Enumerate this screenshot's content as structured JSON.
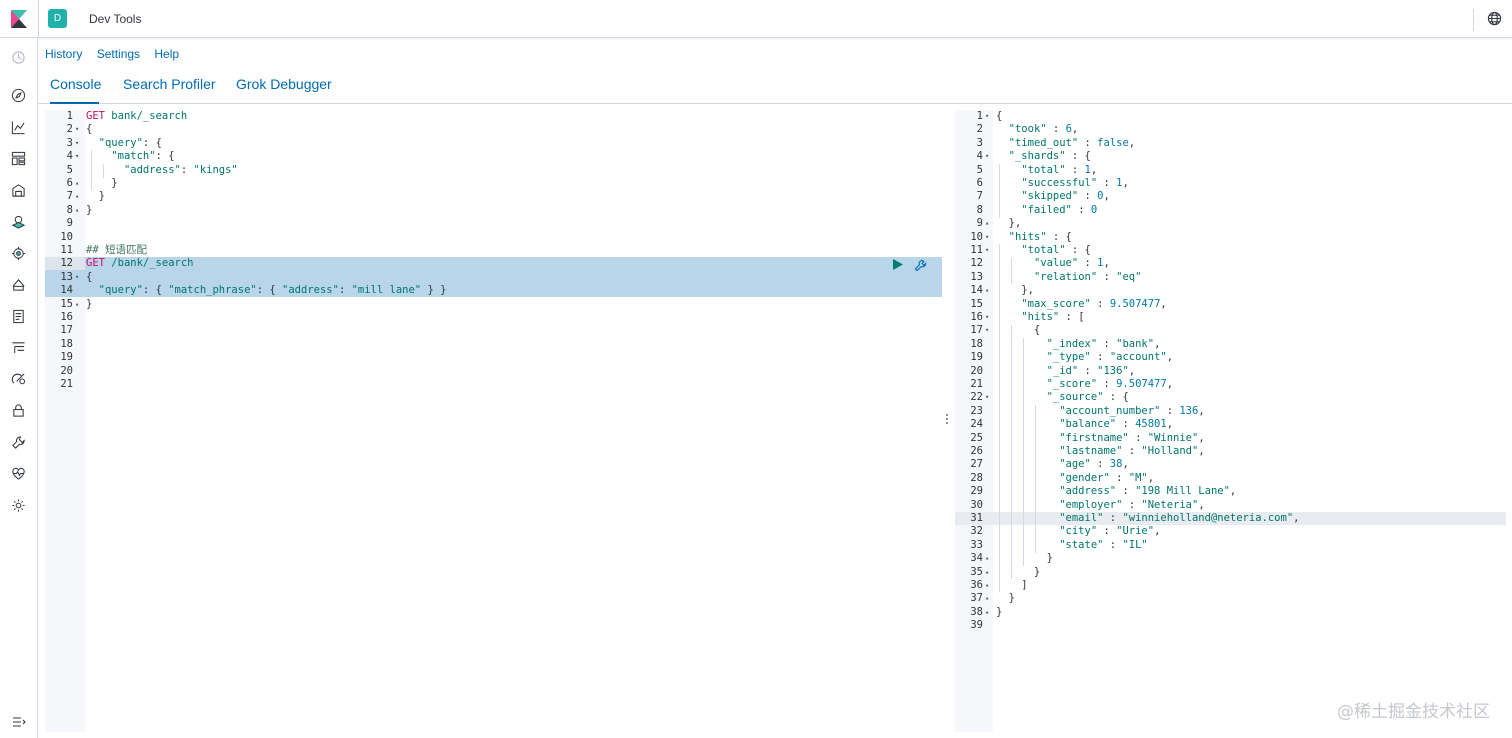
{
  "header": {
    "space_initial": "D",
    "app_title": "Dev Tools"
  },
  "nav_icons": [
    "recently-viewed-icon",
    "discover-icon",
    "visualize-icon",
    "dashboard-icon",
    "canvas-icon",
    "maps-icon",
    "ml-icon",
    "infrastructure-icon",
    "logs-icon",
    "apm-icon",
    "uptime-icon",
    "siem-icon",
    "dev-tools-icon",
    "monitoring-icon",
    "management-icon"
  ],
  "submenu": {
    "history": "History",
    "settings": "Settings",
    "help": "Help"
  },
  "tabs": [
    "Console",
    "Search Profiler",
    "Grok Debugger"
  ],
  "request_lines": [
    {
      "n": "1",
      "fold": "",
      "tokens": [
        [
          "kw",
          "GET "
        ],
        [
          "url",
          "bank/_search"
        ]
      ]
    },
    {
      "n": "2",
      "fold": "▾",
      "tokens": [
        [
          "pun",
          "{"
        ]
      ]
    },
    {
      "n": "3",
      "fold": "▾",
      "tokens": [
        [
          "pun",
          "  "
        ],
        [
          "var",
          "\"query\""
        ],
        [
          "pun",
          ": {"
        ]
      ]
    },
    {
      "n": "4",
      "fold": "▾",
      "tokens": [
        [
          "pun",
          "    "
        ],
        [
          "var",
          "\"match\""
        ],
        [
          "pun",
          ": {"
        ]
      ]
    },
    {
      "n": "5",
      "fold": "",
      "tokens": [
        [
          "pun",
          "      "
        ],
        [
          "var",
          "\"address\""
        ],
        [
          "pun",
          ": "
        ],
        [
          "str",
          "\"kings\""
        ]
      ]
    },
    {
      "n": "6",
      "fold": "▴",
      "tokens": [
        [
          "pun",
          "    }"
        ]
      ]
    },
    {
      "n": "7",
      "fold": "▴",
      "tokens": [
        [
          "pun",
          "  }"
        ]
      ]
    },
    {
      "n": "8",
      "fold": "▴",
      "tokens": [
        [
          "pun",
          "}"
        ]
      ]
    },
    {
      "n": "9",
      "fold": "",
      "tokens": []
    },
    {
      "n": "10",
      "fold": "",
      "tokens": []
    },
    {
      "n": "11",
      "fold": "",
      "tokens": [
        [
          "cmt",
          "## 短语匹配"
        ]
      ]
    },
    {
      "n": "12",
      "fold": "",
      "tokens": [
        [
          "kw",
          "GET "
        ],
        [
          "url",
          "/bank/_search"
        ]
      ]
    },
    {
      "n": "13",
      "fold": "▾",
      "tokens": [
        [
          "pun",
          "{"
        ]
      ]
    },
    {
      "n": "14",
      "fold": "",
      "tokens": [
        [
          "pun",
          "  "
        ],
        [
          "var",
          "\"query\""
        ],
        [
          "pun",
          ": { "
        ],
        [
          "var",
          "\"match_phrase\""
        ],
        [
          "pun",
          ": { "
        ],
        [
          "var",
          "\"address\""
        ],
        [
          "pun",
          ": "
        ],
        [
          "str",
          "\"mill lane\""
        ],
        [
          "pun",
          " } }"
        ]
      ]
    },
    {
      "n": "15",
      "fold": "▴",
      "tokens": [
        [
          "pun",
          "}"
        ]
      ]
    },
    {
      "n": "16",
      "fold": "",
      "tokens": []
    },
    {
      "n": "17",
      "fold": "",
      "tokens": []
    },
    {
      "n": "18",
      "fold": "",
      "tokens": []
    },
    {
      "n": "19",
      "fold": "",
      "tokens": []
    },
    {
      "n": "20",
      "fold": "",
      "tokens": []
    },
    {
      "n": "21",
      "fold": "",
      "tokens": []
    }
  ],
  "response_lines": [
    {
      "n": "1",
      "fold": "▾",
      "tokens": [
        [
          "pun",
          "{"
        ]
      ]
    },
    {
      "n": "2",
      "fold": "",
      "tokens": [
        [
          "pun",
          "  "
        ],
        [
          "var",
          "\"took\""
        ],
        [
          "pun",
          " : "
        ],
        [
          "num",
          "6"
        ],
        [
          "pun",
          ","
        ]
      ]
    },
    {
      "n": "3",
      "fold": "",
      "tokens": [
        [
          "pun",
          "  "
        ],
        [
          "var",
          "\"timed_out\""
        ],
        [
          "pun",
          " : "
        ],
        [
          "lit",
          "false"
        ],
        [
          "pun",
          ","
        ]
      ]
    },
    {
      "n": "4",
      "fold": "▾",
      "tokens": [
        [
          "pun",
          "  "
        ],
        [
          "var",
          "\"_shards\""
        ],
        [
          "pun",
          " : {"
        ]
      ]
    },
    {
      "n": "5",
      "fold": "",
      "tokens": [
        [
          "pun",
          "    "
        ],
        [
          "var",
          "\"total\""
        ],
        [
          "pun",
          " : "
        ],
        [
          "num",
          "1"
        ],
        [
          "pun",
          ","
        ]
      ]
    },
    {
      "n": "6",
      "fold": "",
      "tokens": [
        [
          "pun",
          "    "
        ],
        [
          "var",
          "\"successful\""
        ],
        [
          "pun",
          " : "
        ],
        [
          "num",
          "1"
        ],
        [
          "pun",
          ","
        ]
      ]
    },
    {
      "n": "7",
      "fold": "",
      "tokens": [
        [
          "pun",
          "    "
        ],
        [
          "var",
          "\"skipped\""
        ],
        [
          "pun",
          " : "
        ],
        [
          "num",
          "0"
        ],
        [
          "pun",
          ","
        ]
      ]
    },
    {
      "n": "8",
      "fold": "",
      "tokens": [
        [
          "pun",
          "    "
        ],
        [
          "var",
          "\"failed\""
        ],
        [
          "pun",
          " : "
        ],
        [
          "num",
          "0"
        ]
      ]
    },
    {
      "n": "9",
      "fold": "▴",
      "tokens": [
        [
          "pun",
          "  },"
        ]
      ]
    },
    {
      "n": "10",
      "fold": "▾",
      "tokens": [
        [
          "pun",
          "  "
        ],
        [
          "var",
          "\"hits\""
        ],
        [
          "pun",
          " : {"
        ]
      ]
    },
    {
      "n": "11",
      "fold": "▾",
      "tokens": [
        [
          "pun",
          "    "
        ],
        [
          "var",
          "\"total\""
        ],
        [
          "pun",
          " : {"
        ]
      ]
    },
    {
      "n": "12",
      "fold": "",
      "tokens": [
        [
          "pun",
          "      "
        ],
        [
          "var",
          "\"value\""
        ],
        [
          "pun",
          " : "
        ],
        [
          "num",
          "1"
        ],
        [
          "pun",
          ","
        ]
      ]
    },
    {
      "n": "13",
      "fold": "",
      "tokens": [
        [
          "pun",
          "      "
        ],
        [
          "var",
          "\"relation\""
        ],
        [
          "pun",
          " : "
        ],
        [
          "str",
          "\"eq\""
        ]
      ]
    },
    {
      "n": "14",
      "fold": "▴",
      "tokens": [
        [
          "pun",
          "    },"
        ]
      ]
    },
    {
      "n": "15",
      "fold": "",
      "tokens": [
        [
          "pun",
          "    "
        ],
        [
          "var",
          "\"max_score\""
        ],
        [
          "pun",
          " : "
        ],
        [
          "num",
          "9.507477"
        ],
        [
          "pun",
          ","
        ]
      ]
    },
    {
      "n": "16",
      "fold": "▾",
      "tokens": [
        [
          "pun",
          "    "
        ],
        [
          "var",
          "\"hits\""
        ],
        [
          "pun",
          " : ["
        ]
      ]
    },
    {
      "n": "17",
      "fold": "▾",
      "tokens": [
        [
          "pun",
          "      {"
        ]
      ]
    },
    {
      "n": "18",
      "fold": "",
      "tokens": [
        [
          "pun",
          "        "
        ],
        [
          "var",
          "\"_index\""
        ],
        [
          "pun",
          " : "
        ],
        [
          "str",
          "\"bank\""
        ],
        [
          "pun",
          ","
        ]
      ]
    },
    {
      "n": "19",
      "fold": "",
      "tokens": [
        [
          "pun",
          "        "
        ],
        [
          "var",
          "\"_type\""
        ],
        [
          "pun",
          " : "
        ],
        [
          "str",
          "\"account\""
        ],
        [
          "pun",
          ","
        ]
      ]
    },
    {
      "n": "20",
      "fold": "",
      "tokens": [
        [
          "pun",
          "        "
        ],
        [
          "var",
          "\"_id\""
        ],
        [
          "pun",
          " : "
        ],
        [
          "str",
          "\"136\""
        ],
        [
          "pun",
          ","
        ]
      ]
    },
    {
      "n": "21",
      "fold": "",
      "tokens": [
        [
          "pun",
          "        "
        ],
        [
          "var",
          "\"_score\""
        ],
        [
          "pun",
          " : "
        ],
        [
          "num",
          "9.507477"
        ],
        [
          "pun",
          ","
        ]
      ]
    },
    {
      "n": "22",
      "fold": "▾",
      "tokens": [
        [
          "pun",
          "        "
        ],
        [
          "var",
          "\"_source\""
        ],
        [
          "pun",
          " : {"
        ]
      ]
    },
    {
      "n": "23",
      "fold": "",
      "tokens": [
        [
          "pun",
          "          "
        ],
        [
          "var",
          "\"account_number\""
        ],
        [
          "pun",
          " : "
        ],
        [
          "num",
          "136"
        ],
        [
          "pun",
          ","
        ]
      ]
    },
    {
      "n": "24",
      "fold": "",
      "tokens": [
        [
          "pun",
          "          "
        ],
        [
          "var",
          "\"balance\""
        ],
        [
          "pun",
          " : "
        ],
        [
          "num",
          "45801"
        ],
        [
          "pun",
          ","
        ]
      ]
    },
    {
      "n": "25",
      "fold": "",
      "tokens": [
        [
          "pun",
          "          "
        ],
        [
          "var",
          "\"firstname\""
        ],
        [
          "pun",
          " : "
        ],
        [
          "str",
          "\"Winnie\""
        ],
        [
          "pun",
          ","
        ]
      ]
    },
    {
      "n": "26",
      "fold": "",
      "tokens": [
        [
          "pun",
          "          "
        ],
        [
          "var",
          "\"lastname\""
        ],
        [
          "pun",
          " : "
        ],
        [
          "str",
          "\"Holland\""
        ],
        [
          "pun",
          ","
        ]
      ]
    },
    {
      "n": "27",
      "fold": "",
      "tokens": [
        [
          "pun",
          "          "
        ],
        [
          "var",
          "\"age\""
        ],
        [
          "pun",
          " : "
        ],
        [
          "num",
          "38"
        ],
        [
          "pun",
          ","
        ]
      ]
    },
    {
      "n": "28",
      "fold": "",
      "tokens": [
        [
          "pun",
          "          "
        ],
        [
          "var",
          "\"gender\""
        ],
        [
          "pun",
          " : "
        ],
        [
          "str",
          "\"M\""
        ],
        [
          "pun",
          ","
        ]
      ]
    },
    {
      "n": "29",
      "fold": "",
      "tokens": [
        [
          "pun",
          "          "
        ],
        [
          "var",
          "\"address\""
        ],
        [
          "pun",
          " : "
        ],
        [
          "str",
          "\"198 Mill Lane\""
        ],
        [
          "pun",
          ","
        ]
      ]
    },
    {
      "n": "30",
      "fold": "",
      "tokens": [
        [
          "pun",
          "          "
        ],
        [
          "var",
          "\"employer\""
        ],
        [
          "pun",
          " : "
        ],
        [
          "str",
          "\"Neteria\""
        ],
        [
          "pun",
          ","
        ]
      ]
    },
    {
      "n": "31",
      "fold": "",
      "tokens": [
        [
          "pun",
          "          "
        ],
        [
          "var",
          "\"email\""
        ],
        [
          "pun",
          " : "
        ],
        [
          "str",
          "\"winnieholland@neteria.com\""
        ],
        [
          "pun",
          ","
        ]
      ]
    },
    {
      "n": "32",
      "fold": "",
      "tokens": [
        [
          "pun",
          "          "
        ],
        [
          "var",
          "\"city\""
        ],
        [
          "pun",
          " : "
        ],
        [
          "str",
          "\"Urie\""
        ],
        [
          "pun",
          ","
        ]
      ]
    },
    {
      "n": "33",
      "fold": "",
      "tokens": [
        [
          "pun",
          "          "
        ],
        [
          "var",
          "\"state\""
        ],
        [
          "pun",
          " : "
        ],
        [
          "str",
          "\"IL\""
        ]
      ]
    },
    {
      "n": "34",
      "fold": "▴",
      "tokens": [
        [
          "pun",
          "        }"
        ]
      ]
    },
    {
      "n": "35",
      "fold": "▴",
      "tokens": [
        [
          "pun",
          "      }"
        ]
      ]
    },
    {
      "n": "36",
      "fold": "▴",
      "tokens": [
        [
          "pun",
          "    ]"
        ]
      ]
    },
    {
      "n": "37",
      "fold": "▴",
      "tokens": [
        [
          "pun",
          "  }"
        ]
      ]
    },
    {
      "n": "38",
      "fold": "▴",
      "tokens": [
        [
          "pun",
          "}"
        ]
      ]
    },
    {
      "n": "39",
      "fold": "",
      "tokens": []
    }
  ],
  "watermark": "@稀土掘金技术社区",
  "colors": {
    "accent": "#006bb4",
    "keyword": "#c80a68",
    "string": "#00756c",
    "literal": "#0079a5",
    "selection": "#b9d5ea",
    "space_avatar": "#20b2aa"
  }
}
